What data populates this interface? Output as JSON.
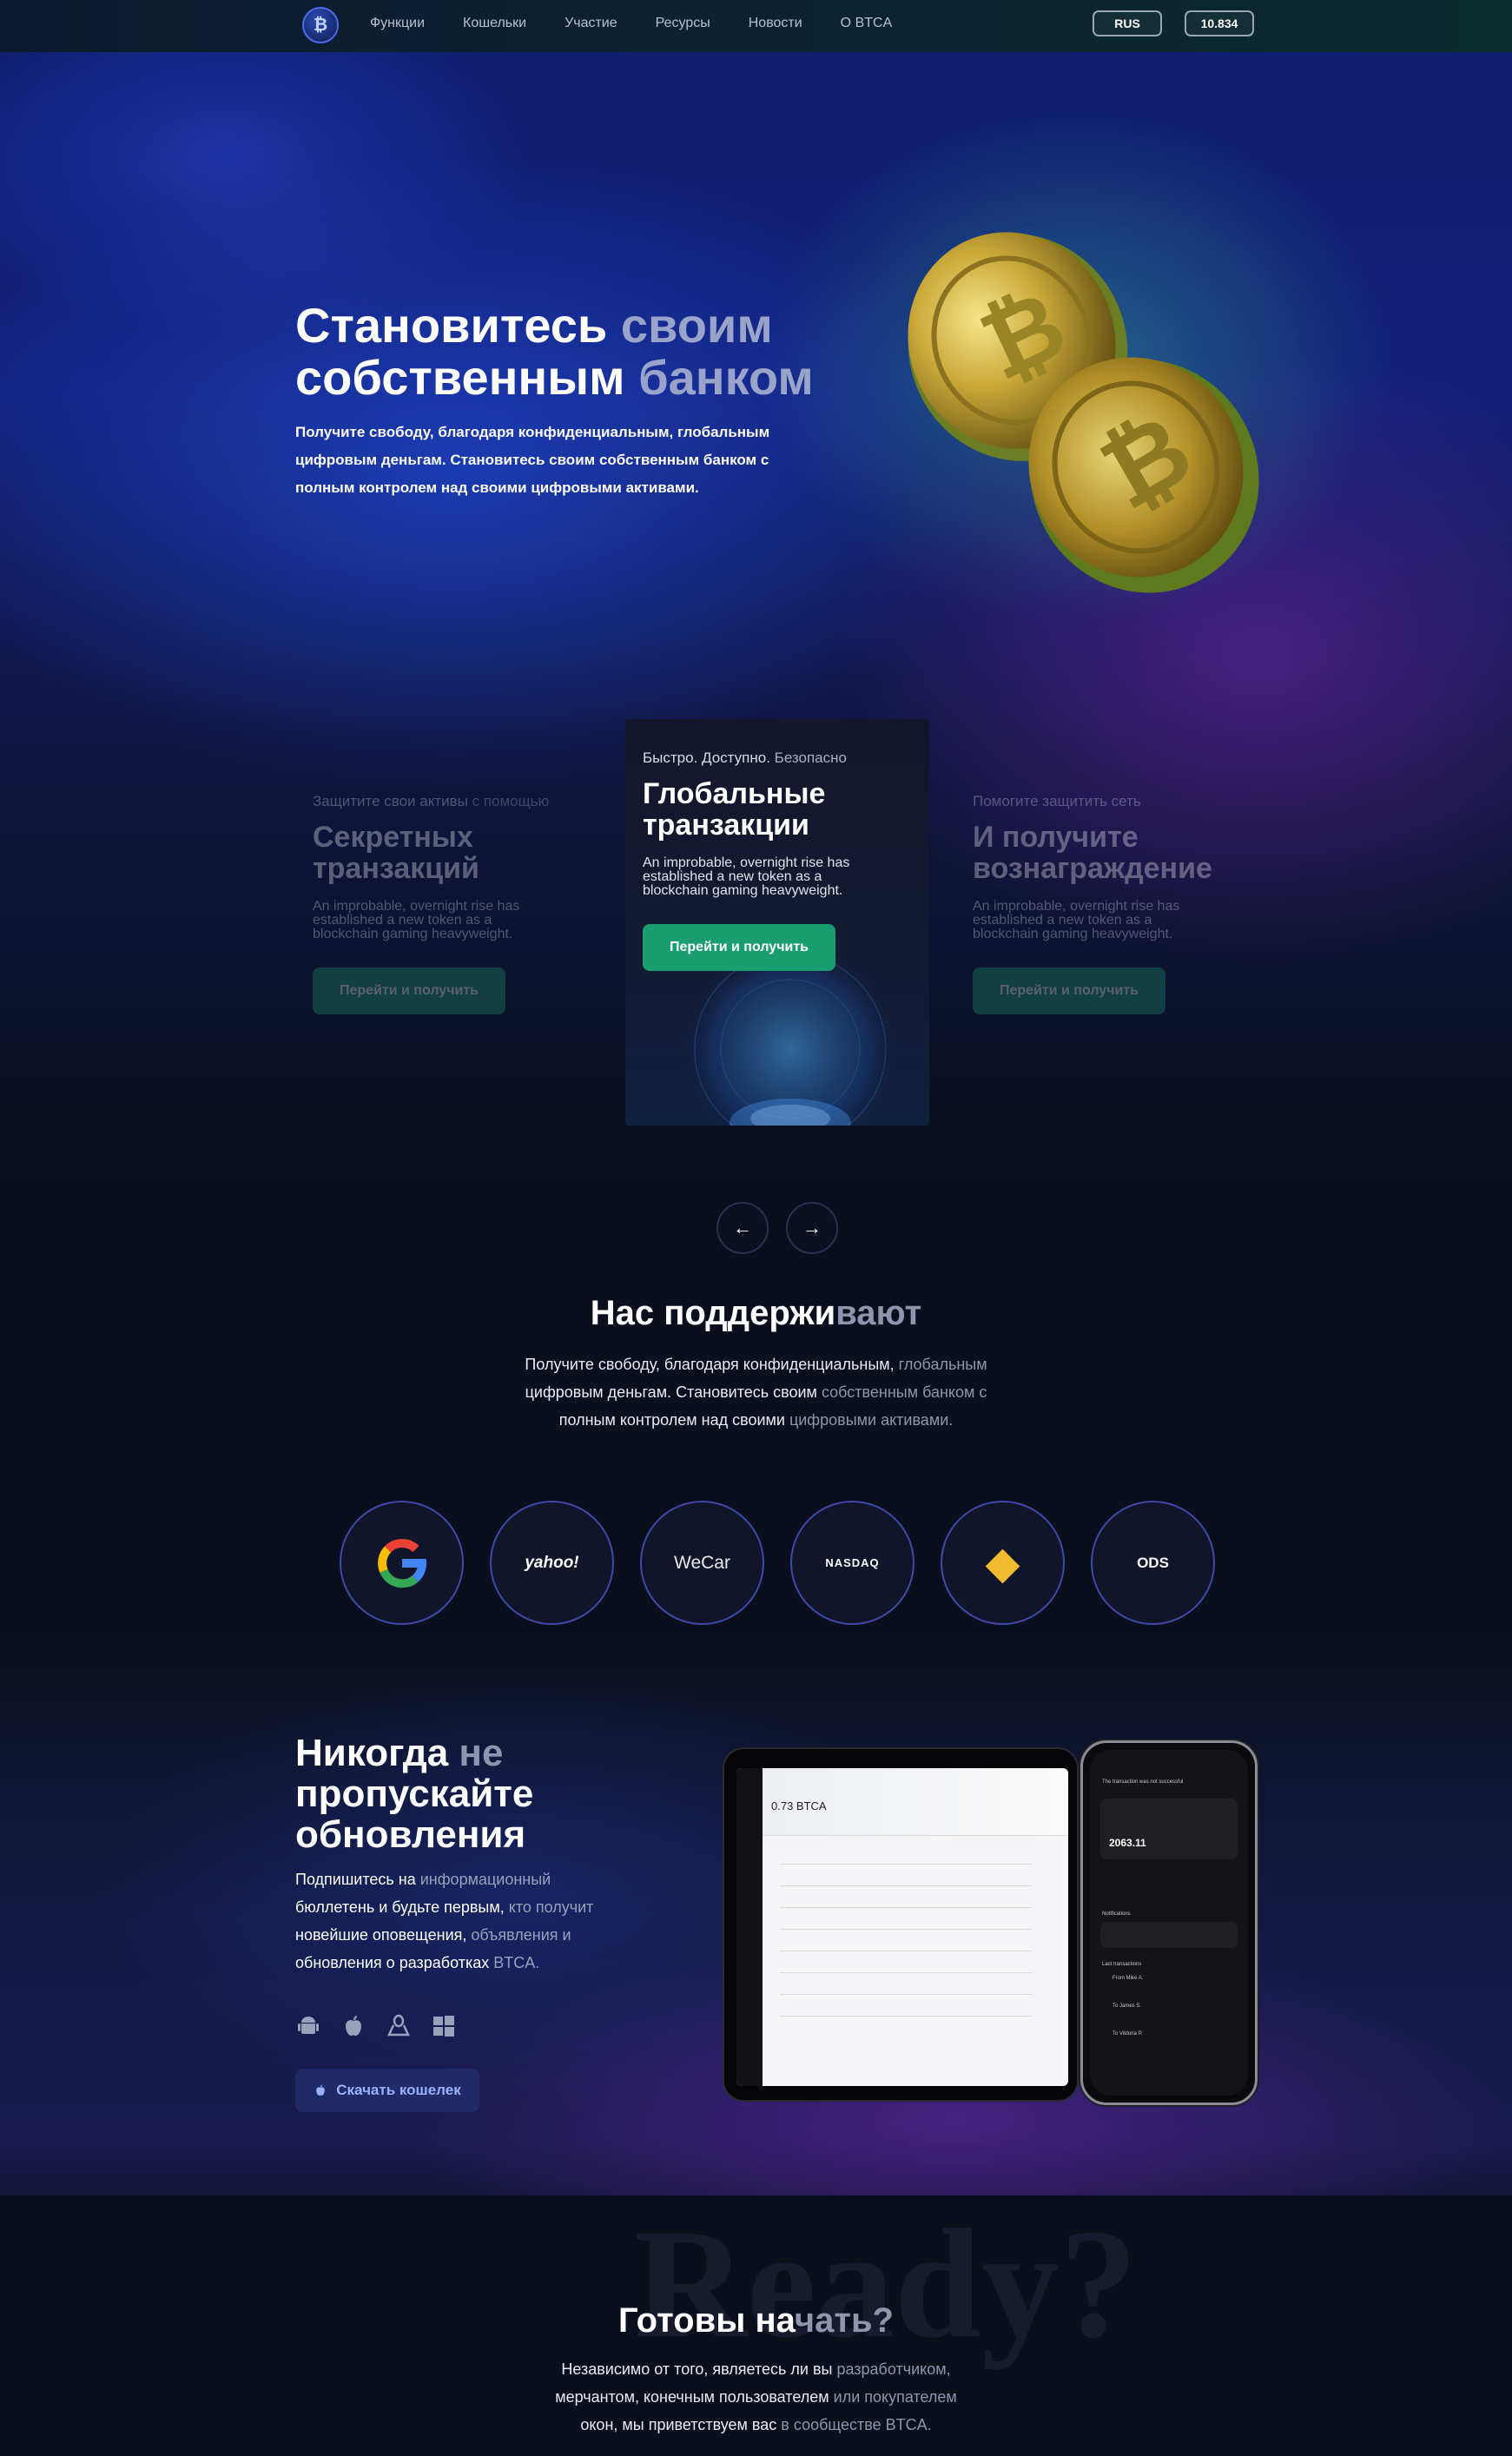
{
  "nav": {
    "links": [
      "Функции",
      "Кошельки",
      "Участие",
      "Ресурсы",
      "Новости",
      "О BTCA"
    ],
    "lang_button": "RUS",
    "price_button": "10.834"
  },
  "hero": {
    "title_line1_bright": "Становитесь",
    "title_line1_muted": " своим",
    "title_line2_bright": "собственным",
    "title_line2_muted": " банком",
    "subtitle_line1": "Получите свободу, благодаря конфиденциальным, глобальным",
    "subtitle_line2": "цифровым деньгам. Становитесь своим собственным банком с",
    "subtitle_line3": "полным контролем над своими цифровыми активами."
  },
  "slider": {
    "left": {
      "kicker_bright": "Защитите свои активы",
      "kicker_dim": " с помощью",
      "title_line1": "Секретных",
      "title_line2": "транзакций",
      "desc_line1": "An improbable, overnight rise has",
      "desc_line2": "established a new token as a",
      "desc_line3": "blockchain gaming heavyweight.",
      "button": "Перейти и получить"
    },
    "center": {
      "kicker_bright": "Быстро. Доступно.",
      "kicker_dim": " Безопасно",
      "title_line1": "Глобальные",
      "title_line2": "транзакции",
      "desc_line1": "An improbable, overnight rise has",
      "desc_line2": "established a new token as a",
      "desc_line3": "blockchain gaming heavyweight.",
      "button": "Перейти и получить"
    },
    "right": {
      "kicker_bright": "Помогите защитить сеть",
      "kicker_dim": "",
      "title_line1": "И получите",
      "title_line2": "вознаграждение",
      "desc_line1": "An improbable, overnight rise has",
      "desc_line2": "established a new token as a",
      "desc_line3": "blockchain gaming heavyweight.",
      "button": "Перейти и получить"
    },
    "prev_icon": "←",
    "next_icon": "→"
  },
  "supporters": {
    "title_bright": "Нас поддержи",
    "title_muted": "вают",
    "sub_line1_bright": "Получите свободу, благодаря конфиденциальным,",
    "sub_line1_dim": " глобальным",
    "sub_line2_bright": "цифровым деньгам. Становитесь своим",
    "sub_line2_dim": " собственным банком с",
    "sub_line3_bright": "полным контролем над своими",
    "sub_line3_dim": " цифровыми активами.",
    "partners": [
      "G",
      "yahoo!",
      "WeCar",
      "NASDAQ",
      "◆",
      "ODS"
    ]
  },
  "updates": {
    "title_line1_bright": "Никогда",
    "title_line1_muted": " не",
    "title_line2": "пропускайте",
    "title_line3": "обновления",
    "desc_line1_bright": "Подпишитесь на",
    "desc_line1_dim": " информационный",
    "desc_line2_bright": "бюллетень и будьте первым,",
    "desc_line2_dim": " кто получит",
    "desc_line3_bright": "новейшие оповещения,",
    "desc_line3_dim": " объявления и",
    "desc_line4_bright": "обновления о разработках",
    "desc_line4_dim": " BTCA.",
    "os_icons": [
      "android-icon",
      "apple-icon",
      "linux-icon",
      "windows-icon"
    ],
    "download_button": "Скачать кошелек",
    "tablet_balance": "0.73 BTCA",
    "phone_balance": "2063.11",
    "phone_notice": "The transaction was not successful",
    "phone_notifications": "Notifications",
    "phone_last": "Last transactions",
    "phone_tx1": "From Mike A.",
    "phone_tx2": "To James S.",
    "phone_tx3": "To Viktoria P."
  },
  "ready": {
    "ghost": "Ready?",
    "title_bright": "Готовы на",
    "title_muted": "чать?",
    "desc_line1_bright": "Независимо от того, являетесь ли вы",
    "desc_line1_dim": " разработчиком,",
    "desc_line2_bright": "мерчантом, конечным пользователем",
    "desc_line2_dim": " или покупателем",
    "desc_line3_bright": "окон, мы приветствуем вас",
    "desc_line3_dim": " в сообществе BTCA."
  },
  "colors": {
    "accent_green": "#1a9e70",
    "brand_blue": "#4c6cf0",
    "muted_text": "#8e95ad"
  }
}
